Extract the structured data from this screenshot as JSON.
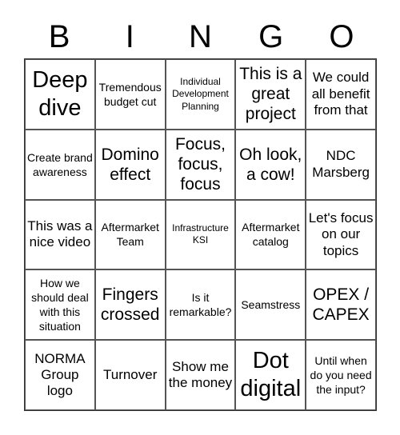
{
  "header": [
    "B",
    "I",
    "N",
    "G",
    "O"
  ],
  "cells": [
    {
      "text": "Deep dive",
      "size": "xl"
    },
    {
      "text": "Tremendous budget cut",
      "size": "s"
    },
    {
      "text": "Individual Development Planning",
      "size": "xs"
    },
    {
      "text": "This is a great project",
      "size": "l"
    },
    {
      "text": "We could all benefit from that",
      "size": "m"
    },
    {
      "text": "Create brand awareness",
      "size": "s"
    },
    {
      "text": "Domino effect",
      "size": "l"
    },
    {
      "text": "Focus, focus, focus",
      "size": "l"
    },
    {
      "text": "Oh look, a cow!",
      "size": "l"
    },
    {
      "text": "NDC Marsberg",
      "size": "m"
    },
    {
      "text": "This was a nice video",
      "size": "m"
    },
    {
      "text": "Aftermarket Team",
      "size": "s"
    },
    {
      "text": "Infrastructure KSI",
      "size": "xs"
    },
    {
      "text": "Aftermarket catalog",
      "size": "s"
    },
    {
      "text": "Let's focus on our topics",
      "size": "m"
    },
    {
      "text": "How we should deal with this situation",
      "size": "s"
    },
    {
      "text": "Fingers crossed",
      "size": "l"
    },
    {
      "text": "Is it remarkable?",
      "size": "s"
    },
    {
      "text": "Seamstress",
      "size": "s"
    },
    {
      "text": "OPEX / CAPEX",
      "size": "l"
    },
    {
      "text": "NORMA Group logo",
      "size": "m"
    },
    {
      "text": "Turnover",
      "size": "m"
    },
    {
      "text": "Show me the money",
      "size": "m"
    },
    {
      "text": "Dot digital",
      "size": "xl"
    },
    {
      "text": "Until when do you need the input?",
      "size": "s"
    }
  ]
}
